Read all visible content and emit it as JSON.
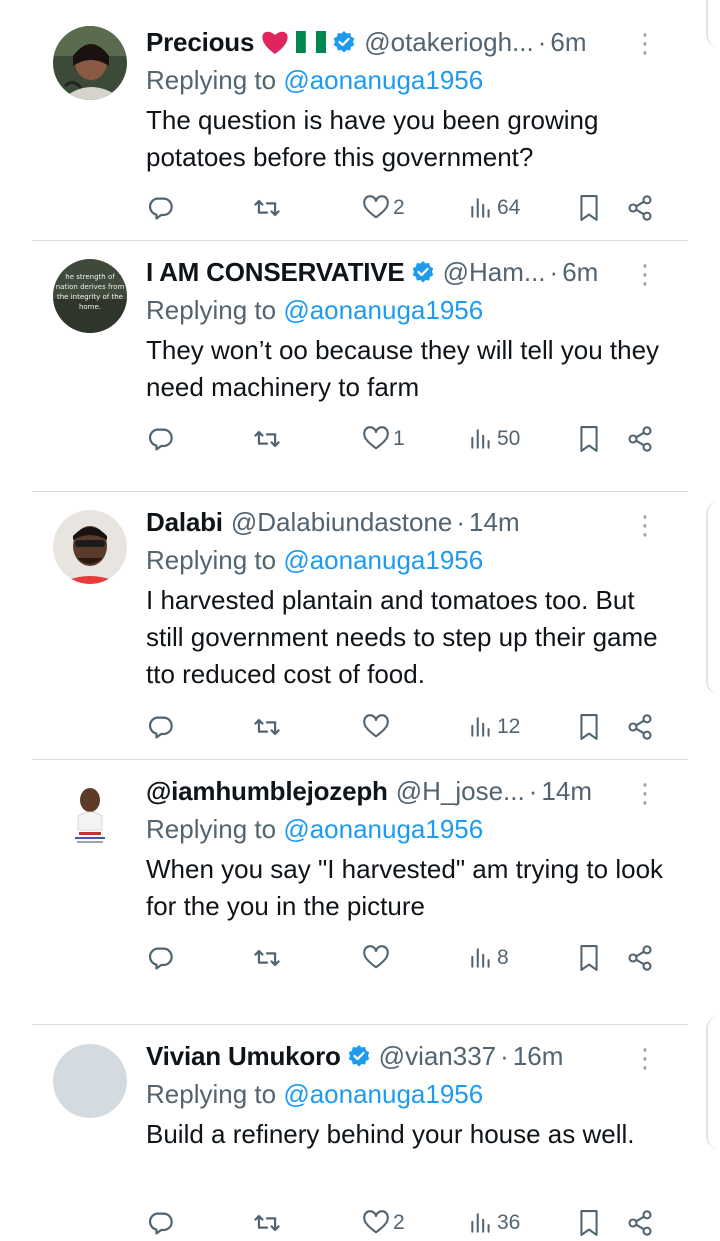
{
  "tweets": [
    {
      "name": "Precious",
      "flag_emoji": true,
      "verified": true,
      "handle": "@otakeriogh...",
      "time": "6m",
      "replying_label": "Replying to ",
      "replying_to": "@aonanuga1956",
      "text": "The question is have you been growing potatoes before this government?",
      "likes": "2",
      "views": "64"
    },
    {
      "name": "I AM CONSERVATIVE",
      "flag_emoji": false,
      "verified": true,
      "handle": "@Ham...",
      "time": "6m",
      "replying_label": "Replying to ",
      "replying_to": "@aonanuga1956",
      "text": "They won’t oo because they will tell you they need machinery to farm",
      "likes": "1",
      "views": "50",
      "avatar_text": [
        "he strength of",
        "nation derives from",
        "the integrity of the",
        "home."
      ]
    },
    {
      "name": "Dalabi",
      "flag_emoji": false,
      "verified": false,
      "handle": "@Dalabiundastone",
      "time": "14m",
      "replying_label": "Replying to ",
      "replying_to": "@aonanuga1956",
      "text": "I harvested plantain and  tomatoes too. But still government needs to step up their game tto reduced cost of food.",
      "likes": "",
      "views": "12"
    },
    {
      "name": "@iamhumblejozeph",
      "flag_emoji": false,
      "verified": false,
      "handle": "@H_jose...",
      "time": "14m",
      "replying_label": "Replying to ",
      "replying_to": "@aonanuga1956",
      "text": "When you say \"I harvested\" am trying to look for the you in the picture",
      "likes": "",
      "views": "8"
    },
    {
      "name": "Vivian Umukoro",
      "flag_emoji": false,
      "verified": true,
      "handle": "@vian337",
      "time": "16m",
      "replying_label": "Replying to ",
      "replying_to": "@aonanuga1956",
      "text": "Build a refinery behind your house as well.",
      "likes": "2",
      "views": "36"
    }
  ],
  "separator": "·",
  "more_glyph": "⋮",
  "icons": [
    "reply-icon",
    "retweet-icon",
    "like-icon",
    "views-icon",
    "bookmark-icon",
    "share-icon",
    "verified-badge-icon",
    "heart-emoji",
    "nigeria-flag-emoji"
  ],
  "colors": {
    "accent": "#1d9bf0",
    "muted": "#536471",
    "text": "#0f1419",
    "heart": "#e0245e",
    "flag_green": "#008751"
  }
}
